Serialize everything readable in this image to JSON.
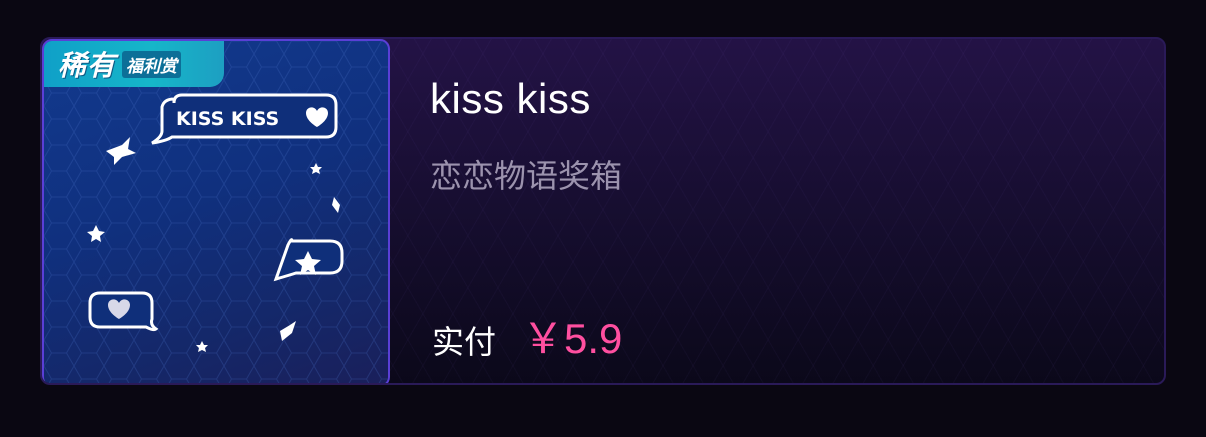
{
  "item": {
    "badge_main": "稀有",
    "badge_sub": "福利赏",
    "sticker_text": "KISS KISS",
    "title": "kiss kiss",
    "subtitle": "恋恋物语奖箱",
    "price_label": "实付",
    "price_value": "￥5.9"
  },
  "colors": {
    "price": "#ff4fa0",
    "badge": "#16b6c9",
    "thumb_border": "#5a3fd6"
  }
}
